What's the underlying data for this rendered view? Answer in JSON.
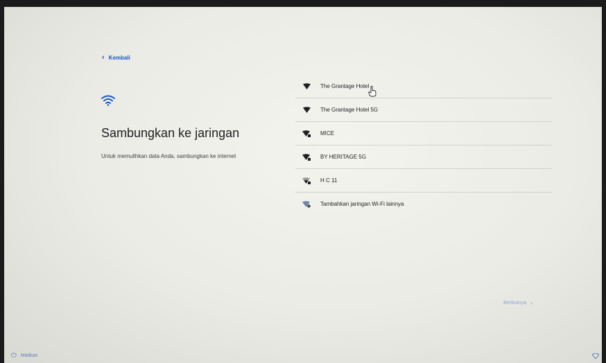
{
  "back_label": "Kembali",
  "page_title": "Sambungkan ke jaringan",
  "subtitle": "Untuk memulihkan data Anda, sambungkan ke internet",
  "networks": [
    {
      "name": "The Grantage Hotel",
      "icon": "wifi-open-icon"
    },
    {
      "name": "The Grantage Hotel 5G",
      "icon": "wifi-open-icon"
    },
    {
      "name": "MICE",
      "icon": "wifi-secured-icon"
    },
    {
      "name": "BY HERITAGE 5G",
      "icon": "wifi-secured-icon"
    },
    {
      "name": "H C 11",
      "icon": "wifi-secured-weak-icon"
    },
    {
      "name": "Tambahkan jaringan Wi-Fi lainnya",
      "icon": "wifi-add-icon"
    }
  ],
  "next_label": "Berikutnya",
  "shutdown_label": "Matikan",
  "colors": {
    "accent": "#1a57c8",
    "background": "#efefe9",
    "text": "#202124"
  }
}
